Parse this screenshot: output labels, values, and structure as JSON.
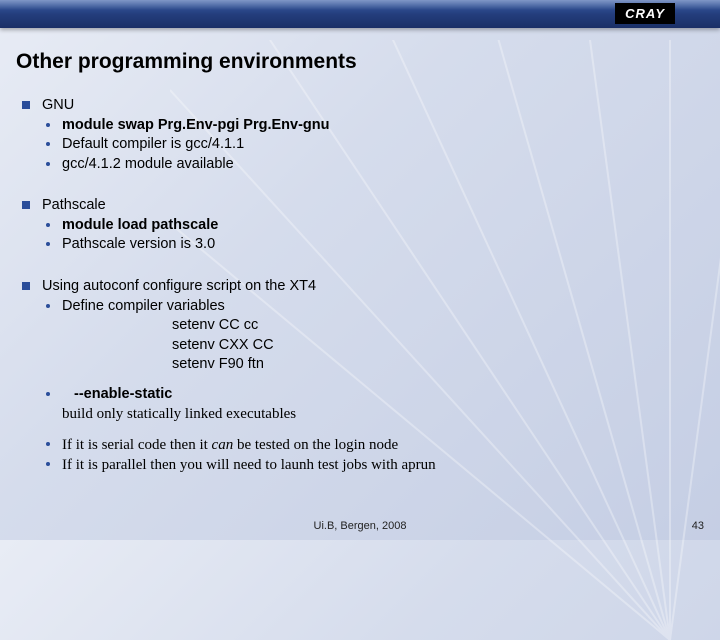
{
  "logo": "CRAY",
  "title": "Other programming environments",
  "section1": {
    "head": "GNU",
    "b1": "module swap Prg.Env-pgi Prg.Env-gnu",
    "b2": "Default compiler is gcc/4.1.1",
    "b3": "gcc/4.1.2 module available"
  },
  "section2": {
    "head": "Pathscale",
    "b1": "module load pathscale",
    "b2": "Pathscale version is 3.0"
  },
  "section3": {
    "head": "Using autoconf configure script on the XT4",
    "b1": "Define compiler variables",
    "c1": "setenv CC cc",
    "c2": "setenv CXX CC",
    "c3": "setenv F90 ftn",
    "b2": "--enable-static",
    "b2desc": "build only statically linked executables",
    "b3a": "If it is serial code then it ",
    "b3b": "can",
    "b3c": " be tested on the login node",
    "b4": "If it is parallel then you will need to launh test jobs with aprun"
  },
  "footer": {
    "center": "Ui.B, Bergen, 2008",
    "right": "43"
  }
}
